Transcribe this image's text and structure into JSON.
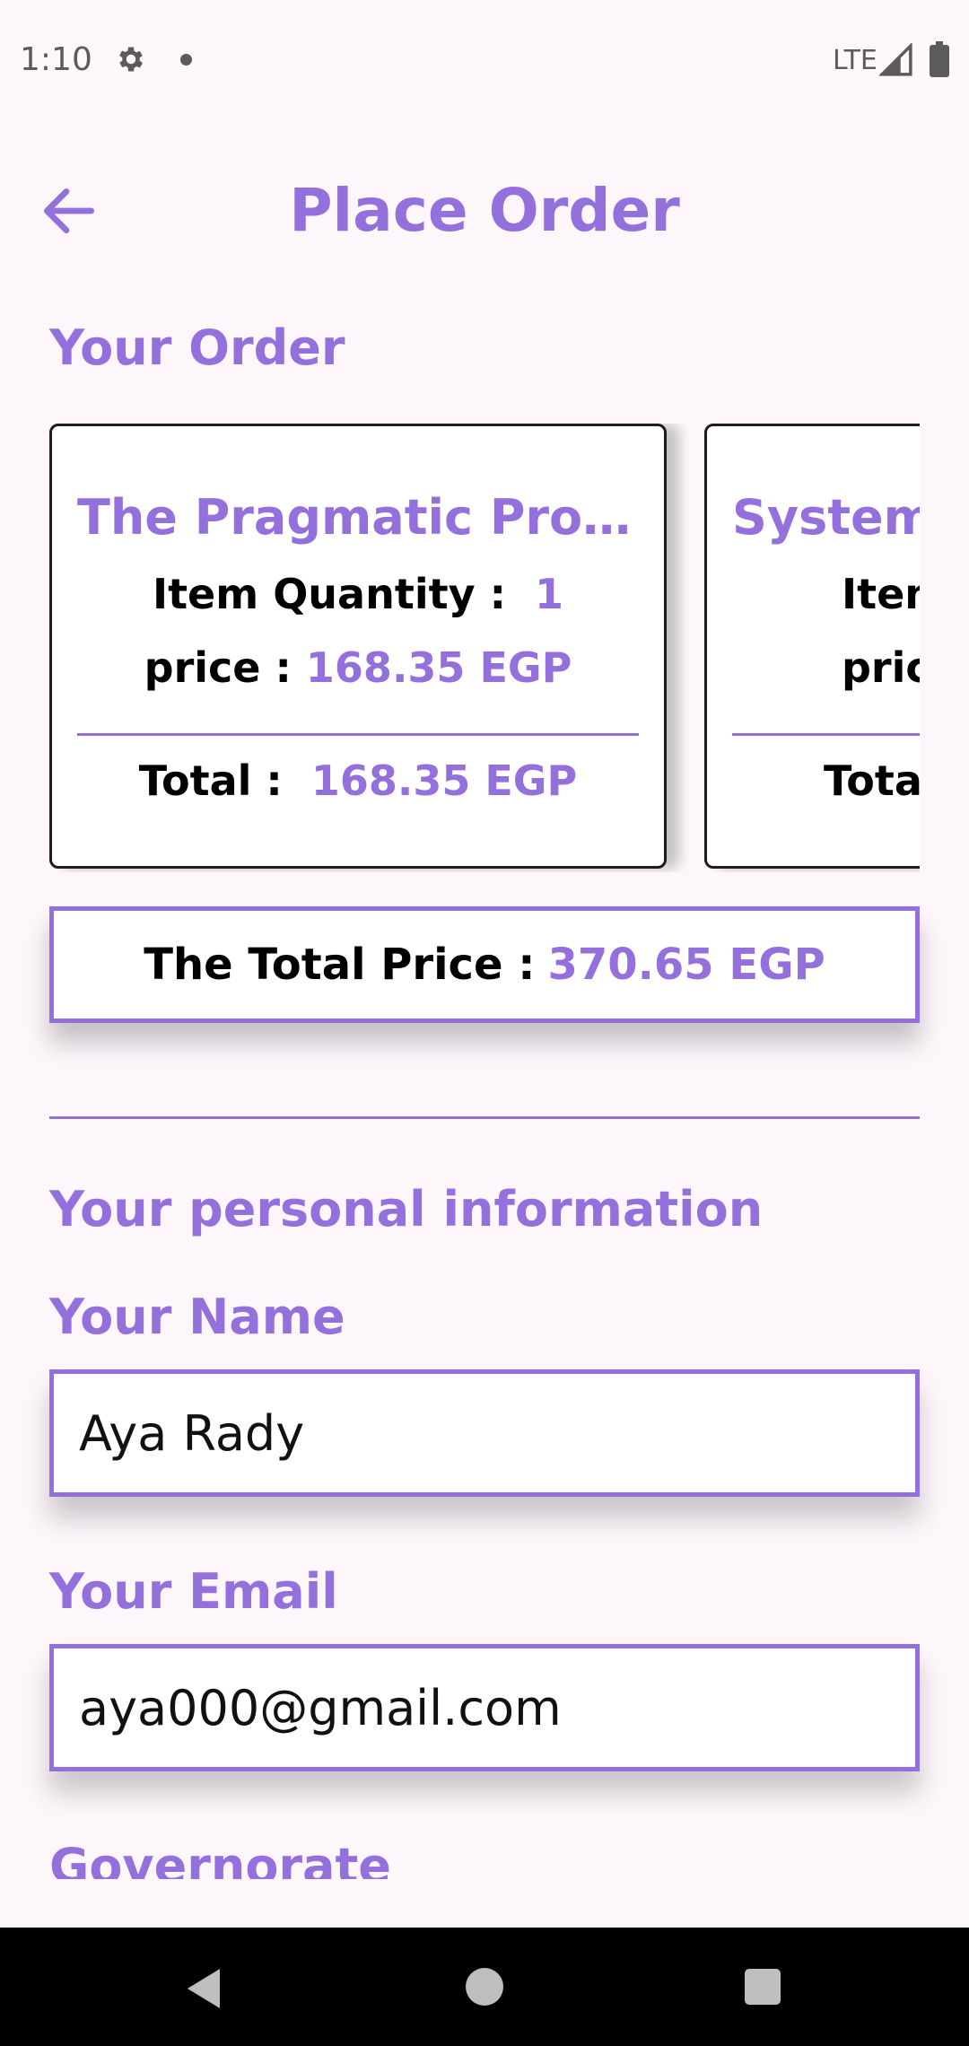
{
  "status_bar": {
    "time": "1:10",
    "network": "LTE"
  },
  "app_bar": {
    "title": "Place Order"
  },
  "order_section": {
    "title": "Your Order",
    "cards": [
      {
        "title": "The Pragmatic Programmer",
        "quantity_label": "Item Quantity :",
        "quantity": "1",
        "price_label": "price :",
        "price": "168.35 EGP",
        "total_label": "Total :",
        "total": "168.35 EGP"
      },
      {
        "title": "System",
        "quantity_label": "Item",
        "price_label": "pric",
        "total_label": "Total"
      }
    ],
    "total_label": "The Total Price :",
    "total_value": "370.65 EGP"
  },
  "personal_section": {
    "title": "Your personal information",
    "name_label": "Your Name",
    "name_value": "Aya Rady",
    "email_label": "Your Email",
    "email_value": "aya000@gmail.com",
    "governorate_label": "Governorate"
  },
  "colors": {
    "accent": "#9370db",
    "background": "#fdf7fc",
    "nav_bar": "#000000"
  }
}
